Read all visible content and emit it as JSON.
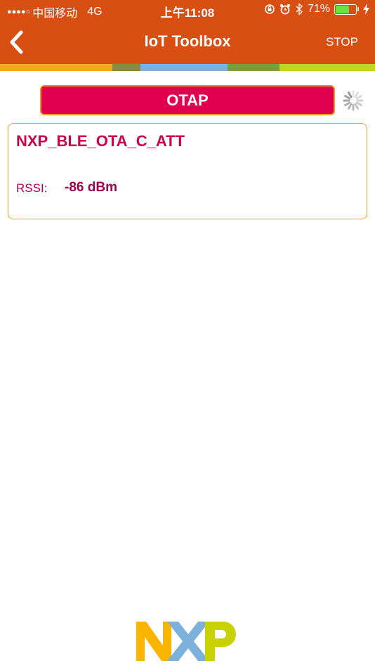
{
  "status_bar": {
    "carrier": "中国移动",
    "network": "4G",
    "time": "上午11:08",
    "battery": "71%",
    "battery_level": 0.71
  },
  "nav": {
    "title": "IoT Toolbox",
    "stop_label": "STOP"
  },
  "otap_button": {
    "label": "OTAP"
  },
  "device": {
    "name": "NXP_BLE_OTA_C_ATT",
    "rssi_label": "RSSI:",
    "rssi_value": "-86 dBm"
  },
  "logo": {
    "text": "NXP"
  },
  "colors": {
    "header": "#d84f14",
    "accent": "#e0004d",
    "stripes": [
      "#f5a623",
      "#8a8b3f",
      "#7fb0dc",
      "#7f9b3a",
      "#c3d32a"
    ]
  }
}
